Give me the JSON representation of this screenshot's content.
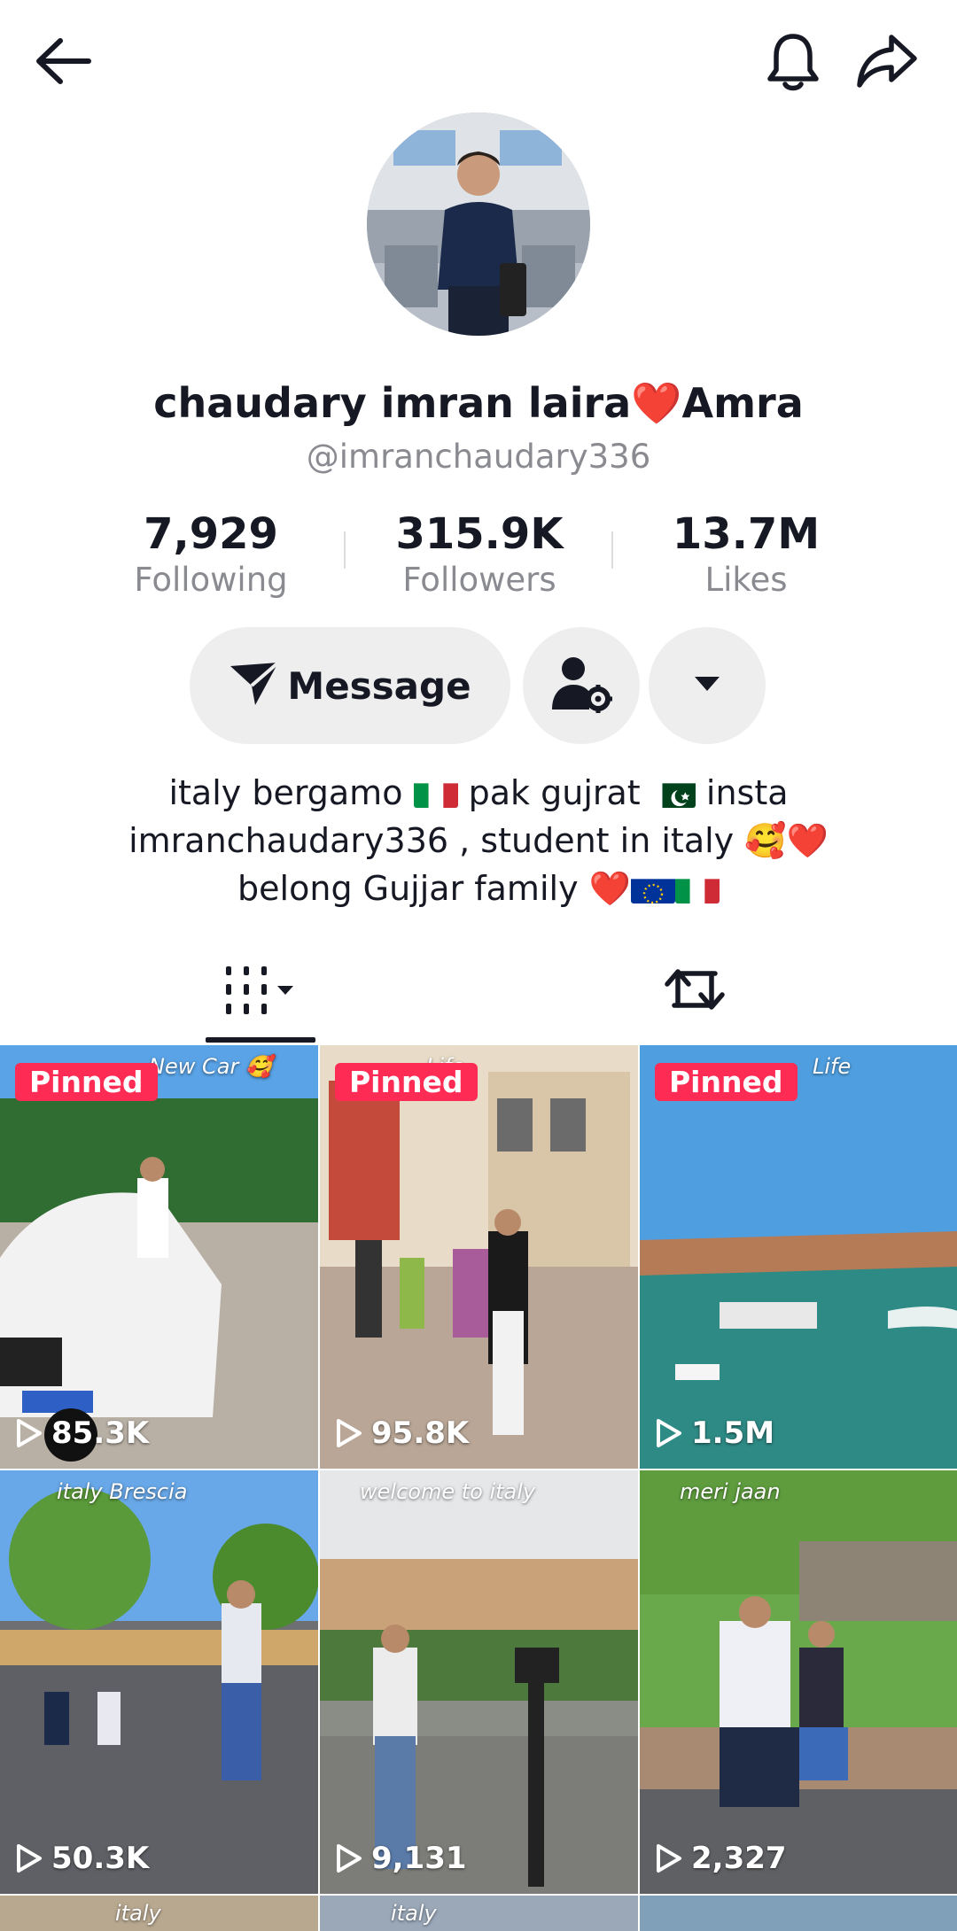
{
  "profile": {
    "name": "chaudary imran laira❤️Amra",
    "handle": "@imranchaudary336"
  },
  "stats": {
    "following": {
      "value": "7,929",
      "label": "Following"
    },
    "followers": {
      "value": "315.9K",
      "label": "Followers"
    },
    "likes": {
      "value": "13.7M",
      "label": "Likes"
    }
  },
  "actions": {
    "message_label": "Message"
  },
  "bio": {
    "line1_a": "italy bergamo",
    "line1_b": "pak gujrat",
    "line1_c": "insta",
    "line2": "imranchaudary336  , student in italy 🥰❤️",
    "line3": "belong Gujjar family ❤️"
  },
  "tabs": {
    "videos_icon": "video-grid-icon",
    "reposts_icon": "repost-icon"
  },
  "videos": [
    {
      "pinned": "Pinned",
      "views": "85.3K",
      "caption": "New Car 🥰"
    },
    {
      "pinned": "Pinned",
      "views": "95.8K",
      "caption": "Life"
    },
    {
      "pinned": "Pinned",
      "views": "1.5M",
      "caption": "Life"
    },
    {
      "pinned": "",
      "views": "50.3K",
      "caption": "italy Brescia"
    },
    {
      "pinned": "",
      "views": "9,131",
      "caption": "welcome to italy"
    },
    {
      "pinned": "",
      "views": "2,327",
      "caption": "meri jaan"
    },
    {
      "pinned": "",
      "views": "",
      "caption": "italy"
    },
    {
      "pinned": "",
      "views": "",
      "caption": "italy"
    }
  ],
  "colors": {
    "accent": "#fe2c55",
    "text_primary": "#161823",
    "text_secondary": "#8a8b91",
    "button_bg": "#eeeeef"
  }
}
